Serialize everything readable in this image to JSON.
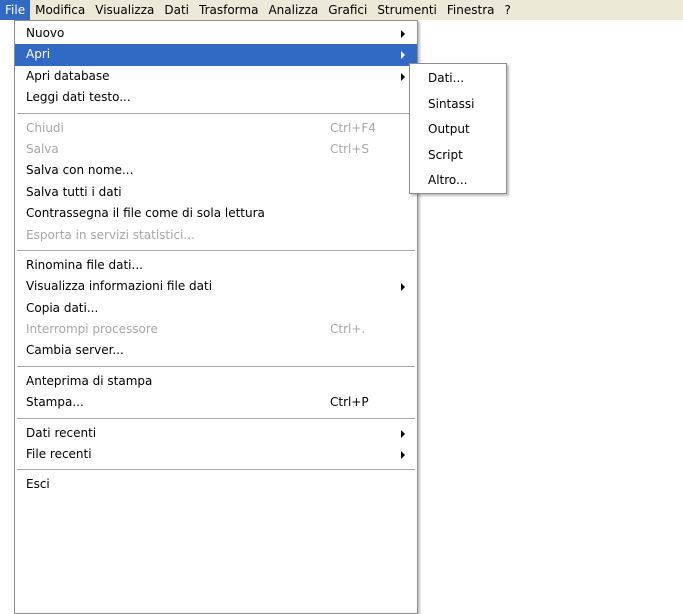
{
  "menubar": {
    "items": [
      "File",
      "Modifica",
      "Visualizza",
      "Dati",
      "Trasforma",
      "Analizza",
      "Grafici",
      "Strumenti",
      "Finestra",
      "?"
    ]
  },
  "file_menu": {
    "groups": [
      [
        {
          "label": "Nuovo",
          "shortcut": "",
          "submenu": true,
          "disabled": false,
          "highlight": false
        },
        {
          "label": "Apri",
          "shortcut": "",
          "submenu": true,
          "disabled": false,
          "highlight": true
        },
        {
          "label": "Apri database",
          "shortcut": "",
          "submenu": true,
          "disabled": false,
          "highlight": false
        },
        {
          "label": "Leggi dati testo...",
          "shortcut": "",
          "submenu": false,
          "disabled": false,
          "highlight": false
        }
      ],
      [
        {
          "label": "Chiudi",
          "shortcut": "Ctrl+F4",
          "submenu": false,
          "disabled": true,
          "highlight": false
        },
        {
          "label": "Salva",
          "shortcut": "Ctrl+S",
          "submenu": false,
          "disabled": true,
          "highlight": false
        },
        {
          "label": "Salva con nome...",
          "shortcut": "",
          "submenu": false,
          "disabled": false,
          "highlight": false
        },
        {
          "label": "Salva tutti i dati",
          "shortcut": "",
          "submenu": false,
          "disabled": false,
          "highlight": false
        },
        {
          "label": "Contrassegna il file come di sola lettura",
          "shortcut": "",
          "submenu": false,
          "disabled": false,
          "highlight": false
        },
        {
          "label": "Esporta in servizi statistici...",
          "shortcut": "",
          "submenu": false,
          "disabled": true,
          "highlight": false
        }
      ],
      [
        {
          "label": "Rinomina file dati...",
          "shortcut": "",
          "submenu": false,
          "disabled": false,
          "highlight": false
        },
        {
          "label": "Visualizza informazioni file dati",
          "shortcut": "",
          "submenu": true,
          "disabled": false,
          "highlight": false
        },
        {
          "label": "Copia dati...",
          "shortcut": "",
          "submenu": false,
          "disabled": false,
          "highlight": false
        },
        {
          "label": "Interrompi processore",
          "shortcut": "Ctrl+.",
          "submenu": false,
          "disabled": true,
          "highlight": false
        },
        {
          "label": "Cambia server...",
          "shortcut": "",
          "submenu": false,
          "disabled": false,
          "highlight": false
        }
      ],
      [
        {
          "label": "Anteprima di stampa",
          "shortcut": "",
          "submenu": false,
          "disabled": false,
          "highlight": false
        },
        {
          "label": "Stampa...",
          "shortcut": "Ctrl+P",
          "submenu": false,
          "disabled": false,
          "highlight": false
        }
      ],
      [
        {
          "label": "Dati recenti",
          "shortcut": "",
          "submenu": true,
          "disabled": false,
          "highlight": false
        },
        {
          "label": "File recenti",
          "shortcut": "",
          "submenu": true,
          "disabled": false,
          "highlight": false
        }
      ],
      [
        {
          "label": "Esci",
          "shortcut": "",
          "submenu": false,
          "disabled": false,
          "highlight": false
        }
      ]
    ]
  },
  "open_submenu": {
    "items": [
      "Dati...",
      "Sintassi",
      "Output",
      "Script",
      "Altro..."
    ]
  },
  "colors": {
    "menubar_bg": "#ece9d8",
    "highlight_bg": "#316ac5",
    "disabled_text": "#a7a6aa",
    "menu_border": "#8d8d8d"
  }
}
